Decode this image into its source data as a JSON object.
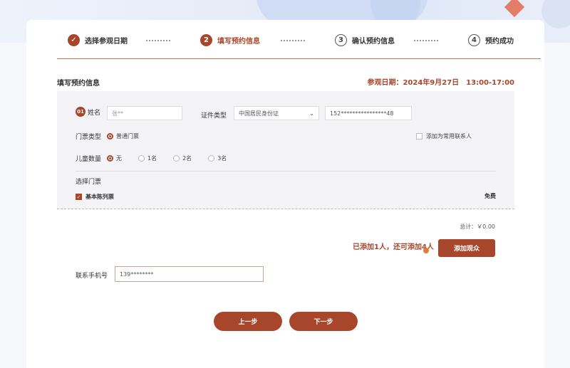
{
  "steps": [
    {
      "num": "✓",
      "label": "选择参观日期",
      "state": "done"
    },
    {
      "num": "2",
      "label": "填写预约信息",
      "state": "active"
    },
    {
      "num": "3",
      "label": "确认预约信息",
      "state": "todo"
    },
    {
      "num": "4",
      "label": "预约成功",
      "state": "todo"
    }
  ],
  "section": {
    "title": "填写预约信息",
    "visit_date": "参观日期：2024年9月27日　13:00-17:00"
  },
  "visitor": {
    "index": "01",
    "name_label": "姓名",
    "name_value": "张**",
    "id_type_label": "证件类型",
    "id_type_value": "中国居民身份证",
    "id_number": "152****************48",
    "ticket_type_label": "门票类型",
    "ticket_type_option": "普通门票",
    "add_contact_label": "添加为常用联系人",
    "children_label": "儿童数量",
    "children_options": [
      "无",
      "1名",
      "2名",
      "3名"
    ],
    "choose_ticket_label": "选择门票",
    "ticket_name": "基本陈列票",
    "ticket_price": "免费"
  },
  "summary": {
    "total": "总计：￥0.00",
    "added_message": "已添加1人，还可添加4人",
    "add_button": "添加观众"
  },
  "contact": {
    "phone_label": "联系手机号",
    "phone_value": "139********"
  },
  "nav": {
    "prev": "上一步",
    "next": "下一步"
  },
  "colors": {
    "accent": "#a7462a",
    "panel": "#f4f4f6"
  }
}
